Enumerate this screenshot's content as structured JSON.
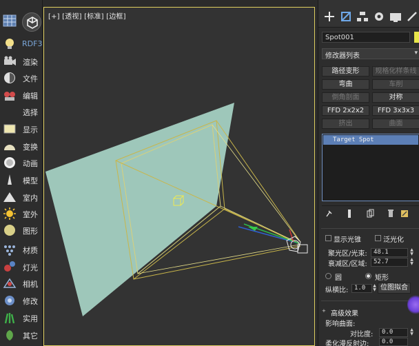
{
  "left_toolbar": {
    "items": [
      {
        "label": "",
        "icon": "grid-icon"
      },
      {
        "label": "RDF3",
        "icon": "light-bulb-icon"
      },
      {
        "label": "渲染",
        "icon": "render-camera-icon"
      },
      {
        "label": "文件",
        "icon": "file-icon"
      },
      {
        "label": "编辑",
        "icon": "edit-icon"
      },
      {
        "label": "选择",
        "icon": "select-icon"
      },
      {
        "label": "显示",
        "icon": "display-icon"
      },
      {
        "label": "变换",
        "icon": "transform-icon"
      },
      {
        "label": "动画",
        "icon": "animation-icon"
      },
      {
        "label": "模型",
        "icon": "model-icon"
      },
      {
        "label": "室内",
        "icon": "interior-icon"
      },
      {
        "label": "室外",
        "icon": "exterior-sun-icon"
      },
      {
        "label": "图形",
        "icon": "shape-icon"
      },
      {
        "label": "材质",
        "icon": "material-icon"
      },
      {
        "label": "灯光",
        "icon": "light-icon"
      },
      {
        "label": "相机",
        "icon": "camera-icon"
      },
      {
        "label": "修改",
        "icon": "modify-icon"
      },
      {
        "label": "实用",
        "icon": "utility-icon"
      },
      {
        "label": "其它",
        "icon": "other-icon"
      }
    ]
  },
  "viewport": {
    "label": "[+] [透视] [标准] [边框]"
  },
  "command_panel": {
    "tabs": [
      "create-plus-icon",
      "modify-icon",
      "hierarchy-icon",
      "motion-icon",
      "display-icon",
      "utilities-icon"
    ],
    "object_name": "Spot001",
    "object_color": "#e8e54a",
    "modifier_list_label": "修改器列表",
    "modifier_buttons": [
      {
        "label": "路径变形",
        "enabled": true
      },
      {
        "label": "规格化样条线",
        "enabled": false
      },
      {
        "label": "弯曲",
        "enabled": true
      },
      {
        "label": "车削",
        "enabled": false
      },
      {
        "label": "倒角剖面",
        "enabled": false
      },
      {
        "label": "对称",
        "enabled": true
      },
      {
        "label": "FFD 2x2x2",
        "enabled": true
      },
      {
        "label": "FFD 3x3x3",
        "enabled": true
      },
      {
        "label": "挤出",
        "enabled": false
      },
      {
        "label": "曲面",
        "enabled": false
      }
    ],
    "stack_item": "Target Spot",
    "cone": {
      "show_cone": "显示光锥",
      "overshoot": "泛光化",
      "hotspot_label": "聚光区/光束:",
      "hotspot_value": "48.1",
      "falloff_label": "衰减区/区域:",
      "falloff_value": "52.7",
      "circle_label": "圆",
      "rectangle_label": "矩形",
      "aspect_label": "纵横比:",
      "aspect_value": "1.0",
      "bitmap_fit_label": "位图拟合"
    },
    "advanced": {
      "title": "高级效果",
      "affect_surfaces": "影响曲面:",
      "contrast_label": "对比度:",
      "contrast_value": "0.0",
      "soften_label": "柔化漫反射边:",
      "soften_value": "0.0"
    }
  }
}
